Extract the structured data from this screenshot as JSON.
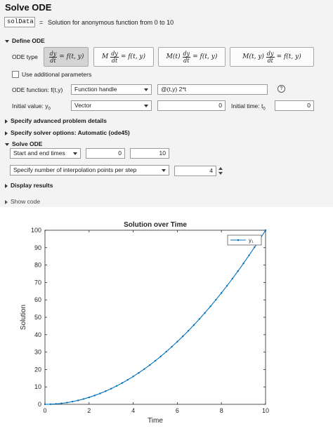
{
  "task": {
    "title": "Solve ODE",
    "output_var": "solData",
    "equals": "=",
    "output_desc": "Solution for anonymous function from 0 to 10"
  },
  "define": {
    "header": "Define ODE",
    "ode_type_label": "ODE type",
    "ode_types": [
      {
        "prefix": "",
        "rhs": "= f(t, y)"
      },
      {
        "prefix": "M",
        "rhs": "= f(t, y)"
      },
      {
        "prefix": "M(t)",
        "rhs": "= f(t, y)"
      },
      {
        "prefix": "M(t, y)",
        "rhs": "= f(t, y)"
      }
    ],
    "frac_num": "dy",
    "frac_den": "dt",
    "selected_type": 0,
    "use_params_label": "Use additional parameters",
    "ode_function_label": "ODE function: f(t,y)",
    "function_type": "Function handle",
    "function_value": "@(t,y) 2*t",
    "initial_value_label": "Initial  value:  y",
    "initial_value_sub": "0",
    "initial_value_type": "Vector",
    "initial_value": "0",
    "initial_time_label": "Initial  time:  t",
    "initial_time_sub": "0",
    "initial_time": "0",
    "help_icon": "?"
  },
  "advanced": {
    "header": "Specify advanced problem details"
  },
  "solver": {
    "header": "Specify solver options: Automatic (ode45)"
  },
  "solve": {
    "header": "Solve ODE",
    "time_mode": "Start and end times",
    "start_time": "0",
    "end_time": "10",
    "interp_mode": "Specify number of interpolation points per step",
    "interp_points": "4"
  },
  "display": {
    "header": "Display results"
  },
  "show_code": "Show code",
  "chart_data": {
    "type": "line",
    "title": "Solution over Time",
    "xlabel": "Time",
    "ylabel": "Solution",
    "xlim": [
      0,
      10
    ],
    "ylim": [
      0,
      100
    ],
    "xticks": [
      0,
      2,
      4,
      6,
      8,
      10
    ],
    "yticks": [
      0,
      10,
      20,
      30,
      40,
      50,
      60,
      70,
      80,
      90,
      100
    ],
    "grid": false,
    "legend": "top-right",
    "color": "#0072bd",
    "series": [
      {
        "name": "y₁",
        "x": [
          0,
          0.25,
          0.5,
          0.75,
          1,
          1.25,
          1.5,
          1.75,
          2,
          2.25,
          2.5,
          2.75,
          3,
          3.25,
          3.5,
          3.75,
          4,
          4.25,
          4.5,
          4.75,
          5,
          5.25,
          5.5,
          5.75,
          6,
          6.25,
          6.5,
          6.75,
          7,
          7.25,
          7.5,
          7.75,
          8,
          8.25,
          8.5,
          8.75,
          9,
          9.25,
          9.5,
          9.75,
          10
        ],
        "values": [
          0,
          0.06,
          0.25,
          0.56,
          1,
          1.56,
          2.25,
          3.06,
          4,
          5.06,
          6.25,
          7.56,
          9,
          10.56,
          12.25,
          14.06,
          16,
          18.06,
          20.25,
          22.56,
          25,
          27.56,
          30.25,
          33.06,
          36,
          39.06,
          42.25,
          45.56,
          49,
          52.56,
          56.25,
          60.06,
          64,
          68.06,
          72.25,
          76.56,
          81,
          85.56,
          90.25,
          95.06,
          100
        ]
      }
    ]
  }
}
